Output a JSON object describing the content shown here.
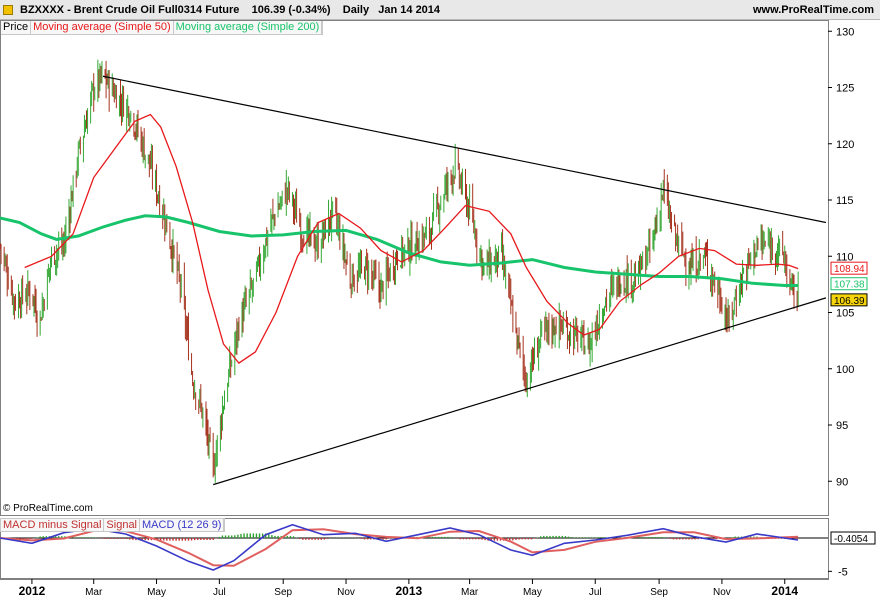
{
  "header": {
    "instrument": "BZXXXX - Brent Crude Oil Full0314 Future",
    "last": "106.39 (-0.34%)",
    "period": "Daily",
    "date": "Jan 14 2014",
    "site": "www.ProRealTime.com",
    "copyright": "© ProRealTime.com"
  },
  "legend": {
    "price": "Price",
    "ma50": "Moving average (Simple 50)",
    "ma200": "Moving average (Simple 200)"
  },
  "macd_legend": {
    "hist": "MACD minus Signal",
    "signal": "Signal",
    "macd": "MACD (12 26 9)"
  },
  "colors": {
    "ma50": "#e8171a",
    "ma200": "#18c46b",
    "up": "#34a834",
    "down": "#a6321e",
    "macd": "#3a3ac8",
    "signal": "#e06060",
    "hist_pos": "#2ea02e",
    "hist_neg": "#c03030",
    "trend": "#000000"
  },
  "chart_data": [
    {
      "type": "line",
      "title": "BZXXXX - Brent Crude Oil Full0314 Future",
      "ylim": [
        87,
        131
      ],
      "y_ticks": [
        90,
        95,
        100,
        105,
        110,
        115,
        120,
        125,
        130
      ],
      "x_ticks": [
        "2012",
        "Mar",
        "May",
        "Jul",
        "Sep",
        "Nov",
        "2013",
        "Mar",
        "May",
        "Jul",
        "Sep",
        "Nov",
        "2014"
      ],
      "x_tick_dates": [
        "2012-01",
        "2012-03",
        "2012-05",
        "2012-07",
        "2012-09",
        "2012-11",
        "2013-01",
        "2013-03",
        "2013-05",
        "2013-07",
        "2013-09",
        "2013-11",
        "2014-01"
      ],
      "price_path": [
        [
          "2011-12-01",
          111
        ],
        [
          "2011-12-15",
          106
        ],
        [
          "2012-01-01",
          107
        ],
        [
          "2012-01-08",
          104
        ],
        [
          "2012-01-20",
          110
        ],
        [
          "2012-02-01",
          111
        ],
        [
          "2012-02-15",
          119
        ],
        [
          "2012-03-01",
          125
        ],
        [
          "2012-03-10",
          126
        ],
        [
          "2012-03-25",
          124
        ],
        [
          "2012-04-05",
          123
        ],
        [
          "2012-04-25",
          118
        ],
        [
          "2012-05-10",
          113
        ],
        [
          "2012-05-25",
          107
        ],
        [
          "2012-06-05",
          99
        ],
        [
          "2012-06-15",
          96
        ],
        [
          "2012-06-25",
          91
        ],
        [
          "2012-07-05",
          97
        ],
        [
          "2012-07-20",
          104
        ],
        [
          "2012-08-05",
          108
        ],
        [
          "2012-08-20",
          113
        ],
        [
          "2012-09-05",
          116
        ],
        [
          "2012-09-20",
          112
        ],
        [
          "2012-10-05",
          111
        ],
        [
          "2012-10-20",
          114
        ],
        [
          "2012-11-05",
          108
        ],
        [
          "2012-11-20",
          109
        ],
        [
          "2012-12-05",
          107
        ],
        [
          "2012-12-20",
          110
        ],
        [
          "2013-01-05",
          111
        ],
        [
          "2013-01-20",
          112
        ],
        [
          "2013-02-05",
          116
        ],
        [
          "2013-02-15",
          118
        ],
        [
          "2013-03-01",
          114
        ],
        [
          "2013-03-15",
          109
        ],
        [
          "2013-04-01",
          110
        ],
        [
          "2013-04-15",
          103
        ],
        [
          "2013-04-25",
          99
        ],
        [
          "2013-05-10",
          103
        ],
        [
          "2013-05-25",
          104
        ],
        [
          "2013-06-10",
          103
        ],
        [
          "2013-06-25",
          102
        ],
        [
          "2013-07-10",
          106
        ],
        [
          "2013-07-25",
          108
        ],
        [
          "2013-08-10",
          108
        ],
        [
          "2013-08-25",
          111
        ],
        [
          "2013-09-05",
          116
        ],
        [
          "2013-09-15",
          112
        ],
        [
          "2013-10-01",
          109
        ],
        [
          "2013-10-15",
          110
        ],
        [
          "2013-11-01",
          106
        ],
        [
          "2013-11-07",
          104
        ],
        [
          "2013-11-20",
          108
        ],
        [
          "2013-12-05",
          111
        ],
        [
          "2013-12-20",
          111
        ],
        [
          "2013-12-31",
          110
        ],
        [
          "2014-01-07",
          107
        ],
        [
          "2014-01-14",
          106.4
        ]
      ],
      "series": [
        {
          "name": "Moving average (Simple 50)",
          "points": [
            [
              "2011-12-25",
              109
            ],
            [
              "2012-01-20",
              110
            ],
            [
              "2012-02-10",
              112
            ],
            [
              "2012-03-01",
              117
            ],
            [
              "2012-03-25",
              120
            ],
            [
              "2012-04-10",
              122
            ],
            [
              "2012-04-25",
              122.6
            ],
            [
              "2012-05-05",
              121.5
            ],
            [
              "2012-05-20",
              118
            ],
            [
              "2012-06-05",
              113
            ],
            [
              "2012-06-20",
              107
            ],
            [
              "2012-07-05",
              102.2
            ],
            [
              "2012-07-20",
              100.5
            ],
            [
              "2012-08-05",
              101.5
            ],
            [
              "2012-08-25",
              105
            ],
            [
              "2012-09-15",
              110
            ],
            [
              "2012-10-05",
              113
            ],
            [
              "2012-10-25",
              113.8
            ],
            [
              "2012-11-15",
              112.5
            ],
            [
              "2012-12-05",
              110.5
            ],
            [
              "2012-12-25",
              109.5
            ],
            [
              "2013-01-15",
              110.5
            ],
            [
              "2013-02-05",
              112.5
            ],
            [
              "2013-02-25",
              114.5
            ],
            [
              "2013-03-20",
              114
            ],
            [
              "2013-04-10",
              112
            ],
            [
              "2013-04-25",
              109
            ],
            [
              "2013-05-15",
              106
            ],
            [
              "2013-06-05",
              104
            ],
            [
              "2013-06-20",
              103
            ],
            [
              "2013-07-05",
              103.5
            ],
            [
              "2013-07-25",
              106
            ],
            [
              "2013-08-15",
              107.5
            ],
            [
              "2013-09-01",
              108.5
            ],
            [
              "2013-09-20",
              110
            ],
            [
              "2013-10-10",
              110.7
            ],
            [
              "2013-10-25",
              110.5
            ],
            [
              "2013-11-15",
              109.3
            ],
            [
              "2013-12-05",
              109.2
            ],
            [
              "2013-12-25",
              109.3
            ],
            [
              "2014-01-05",
              109.2
            ],
            [
              "2014-01-14",
              108.9
            ]
          ],
          "last": 108.94
        },
        {
          "name": "Moving average (Simple 200)",
          "points": [
            [
              "2011-12-01",
              113.4
            ],
            [
              "2011-12-20",
              113
            ],
            [
              "2012-01-10",
              112
            ],
            [
              "2012-01-25",
              111.5
            ],
            [
              "2012-02-15",
              111.8
            ],
            [
              "2012-03-10",
              112.6
            ],
            [
              "2012-04-01",
              113.2
            ],
            [
              "2012-04-20",
              113.6
            ],
            [
              "2012-05-10",
              113.5
            ],
            [
              "2012-06-01",
              113
            ],
            [
              "2012-07-01",
              112.2
            ],
            [
              "2012-08-01",
              111.8
            ],
            [
              "2012-09-01",
              111.9
            ],
            [
              "2012-10-01",
              112.2
            ],
            [
              "2012-11-01",
              112.3
            ],
            [
              "2012-12-01",
              111.5
            ],
            [
              "2013-01-01",
              110.3
            ],
            [
              "2013-02-01",
              109.5
            ],
            [
              "2013-03-01",
              109.2
            ],
            [
              "2013-04-01",
              109.4
            ],
            [
              "2013-05-01",
              109.7
            ],
            [
              "2013-06-01",
              109
            ],
            [
              "2013-07-01",
              108.6
            ],
            [
              "2013-08-01",
              108.4
            ],
            [
              "2013-09-01",
              108.2
            ],
            [
              "2013-10-01",
              108.2
            ],
            [
              "2013-11-01",
              108
            ],
            [
              "2013-12-01",
              107.6
            ],
            [
              "2014-01-01",
              107.4
            ],
            [
              "2014-01-14",
              107.4
            ]
          ],
          "last": 107.38
        }
      ],
      "trendlines": [
        {
          "from": [
            "2012-03-10",
            126
          ],
          "to": [
            "2014-02-10",
            113
          ]
        },
        {
          "from": [
            "2012-06-25",
            89.7
          ],
          "to": [
            "2014-02-10",
            106.3
          ]
        }
      ],
      "last_labels": [
        {
          "value": 108.94,
          "series": "Moving average (Simple 50)"
        },
        {
          "value": 107.38,
          "series": "Moving average (Simple 200)"
        },
        {
          "value": 106.39,
          "series": "Price"
        }
      ]
    },
    {
      "type": "line",
      "title": "MACD (12 26 9)",
      "ylim": [
        -6,
        3
      ],
      "y_ticks": [
        -5
      ],
      "macd": [
        [
          "2011-12-01",
          0
        ],
        [
          "2012-01-01",
          -0.8
        ],
        [
          "2012-02-01",
          0.8
        ],
        [
          "2012-03-01",
          1.4
        ],
        [
          "2012-04-01",
          0.6
        ],
        [
          "2012-05-01",
          -1.2
        ],
        [
          "2012-06-01",
          -3.5
        ],
        [
          "2012-06-25",
          -4.8
        ],
        [
          "2012-07-15",
          -3.4
        ],
        [
          "2012-08-15",
          0.5
        ],
        [
          "2012-09-10",
          2.0
        ],
        [
          "2012-10-10",
          0.5
        ],
        [
          "2012-11-10",
          0.7
        ],
        [
          "2012-12-10",
          -0.5
        ],
        [
          "2013-01-10",
          0.5
        ],
        [
          "2013-02-10",
          1.5
        ],
        [
          "2013-03-10",
          0.5
        ],
        [
          "2013-04-10",
          -1.8
        ],
        [
          "2013-05-01",
          -2.6
        ],
        [
          "2013-06-01",
          -0.8
        ],
        [
          "2013-07-01",
          -0.3
        ],
        [
          "2013-08-01",
          0.4
        ],
        [
          "2013-09-05",
          1.4
        ],
        [
          "2013-10-05",
          0.2
        ],
        [
          "2013-11-05",
          -0.6
        ],
        [
          "2013-12-05",
          0.6
        ],
        [
          "2014-01-14",
          -0.3
        ]
      ],
      "last": -0.4054
    }
  ]
}
